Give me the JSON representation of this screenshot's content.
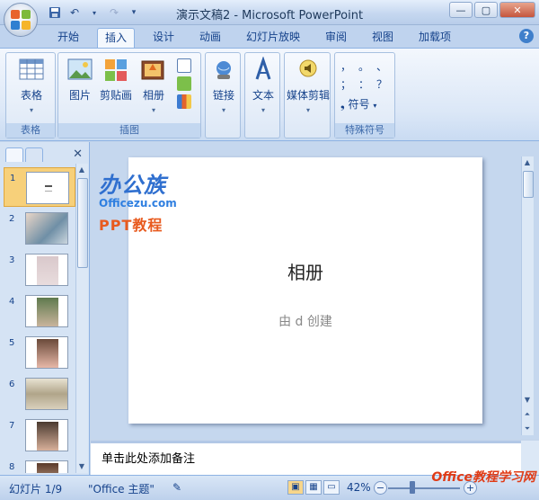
{
  "window": {
    "title": "演示文稿2 - Microsoft PowerPoint"
  },
  "qat": {
    "icons": [
      "save-icon",
      "undo-icon",
      "redo-icon",
      "customize-icon"
    ]
  },
  "tabs": [
    {
      "label": "开始"
    },
    {
      "label": "插入"
    },
    {
      "label": "设计"
    },
    {
      "label": "动画"
    },
    {
      "label": "幻灯片放映"
    },
    {
      "label": "审阅"
    },
    {
      "label": "视图"
    },
    {
      "label": "加载项"
    }
  ],
  "ribbon": {
    "groups": {
      "table": {
        "label": "表格",
        "button": "表格"
      },
      "illustrations": {
        "label": "插图",
        "picture": "图片",
        "clipart": "剪贴画",
        "album": "相册"
      },
      "links": {
        "button": "链接"
      },
      "text": {
        "button": "文本"
      },
      "media": {
        "button": "媒体剪辑"
      },
      "symbols": {
        "label": "特殊符号",
        "button": "符号",
        "chars": [
          "，",
          "。",
          "、",
          "；",
          "：",
          "？"
        ]
      }
    }
  },
  "slides": {
    "numbers": [
      "1",
      "2",
      "3",
      "4",
      "5",
      "6",
      "7",
      "8"
    ],
    "selected": 1
  },
  "slide": {
    "title": "相册",
    "subtitle": "由 d 创建"
  },
  "watermark": {
    "brand": "办公族",
    "site": "Officezu.com",
    "course": "PPT教程"
  },
  "notes": {
    "text": "单击此处添加备注"
  },
  "status": {
    "slide_pos": "幻灯片 1/9",
    "theme": "\"Office 主题\"",
    "zoom": "42%"
  },
  "footer_watermark": {
    "text": "Office教程学习网"
  },
  "colors": {
    "accent": "#15428b",
    "selected": "#f7d07a",
    "brand_blue": "#2f6fcf",
    "brand_orange": "#e85a1e"
  }
}
